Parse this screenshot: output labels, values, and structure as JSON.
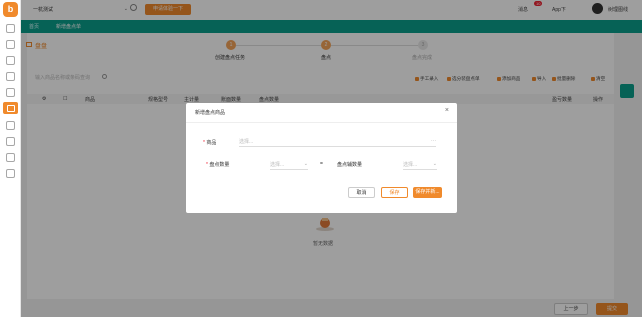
{
  "topbar": {
    "store": "一杭测试",
    "trial_button": "申请体验一下",
    "message": "消息",
    "message_count": "10",
    "app": "App下",
    "user": "树理图线"
  },
  "tabs": [
    {
      "label": "首页"
    },
    {
      "label": "新增盘点单"
    }
  ],
  "page": {
    "title": "盘盘"
  },
  "steps": [
    {
      "num": "1",
      "label": "创建盘点任务"
    },
    {
      "num": "2",
      "label": "盘点"
    },
    {
      "num": "3",
      "label": "盘点完成"
    }
  ],
  "toolbar": {
    "search_placeholder": "输入商品名称或条码查询",
    "items": [
      "手工录入",
      "选分装盘点单",
      "添加商品",
      "导入",
      "批量删除",
      "清空"
    ]
  },
  "table": {
    "headers": [
      "商品",
      "规格型号",
      "主计量",
      "账面数量",
      "盘点数量",
      "盈亏数量",
      "操作"
    ]
  },
  "empty": {
    "text": "暂无数据"
  },
  "modal": {
    "title": "新增盘点商品",
    "product_label": "商品",
    "product_placeholder": "选择...",
    "qty_label": "盘点数量",
    "qty_placeholder": "选择...",
    "equals": "=",
    "aux_label": "盘点辅数量",
    "aux_placeholder": "选择...",
    "cancel": "取消",
    "save": "保存",
    "save_new": "保存并新..."
  },
  "footer": {
    "prev": "上一步",
    "next": "提交"
  },
  "colors": {
    "accent": "#f08a2c",
    "teal": "#0a9e8c"
  }
}
